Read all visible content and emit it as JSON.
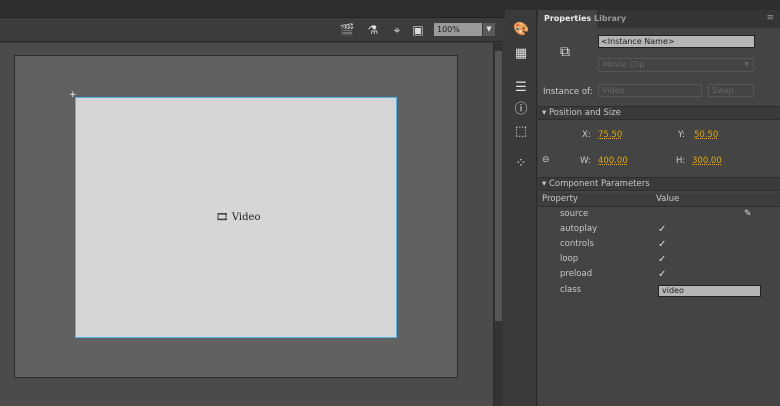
{
  "toolbar": {
    "zoom": "100%"
  },
  "stage": {
    "symbol_label": "Video"
  },
  "panel": {
    "tabs": [
      "Properties",
      "Library"
    ],
    "instance_name_placeholder": "<Instance Name>",
    "symbol_type": "Movie Clip",
    "instance_of_label": "Instance of:",
    "instance_of_value": "Video",
    "swap_label": "Swap...",
    "position_section": "Position and Size",
    "x_label": "X:",
    "x": "75.50",
    "y_label": "Y:",
    "y": "50.50",
    "w_label": "W:",
    "w": "400.00",
    "h_label": "H:",
    "h": "300.00",
    "component_section": "Component Parameters",
    "col_property": "Property",
    "col_value": "Value",
    "params": [
      {
        "name": "source"
      },
      {
        "name": "autoplay",
        "checked": true
      },
      {
        "name": "controls",
        "checked": true
      },
      {
        "name": "loop",
        "checked": true
      },
      {
        "name": "preload",
        "checked": true
      },
      {
        "name": "class",
        "value": "video"
      }
    ]
  }
}
